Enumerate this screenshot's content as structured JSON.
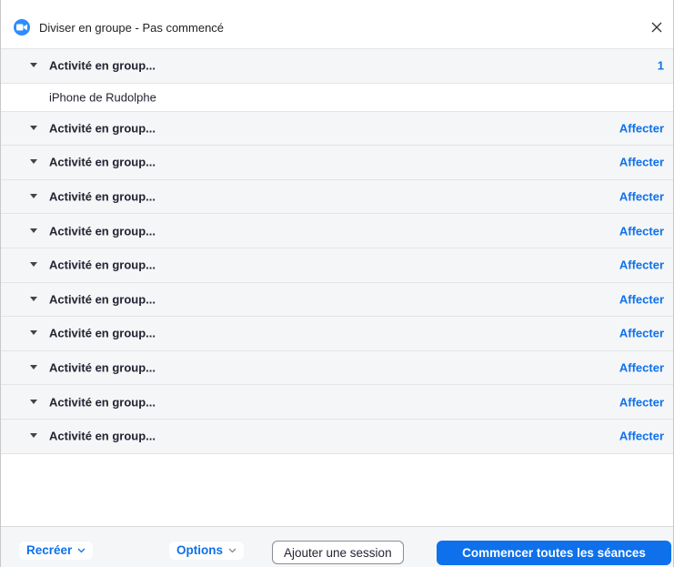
{
  "window": {
    "title": "Diviser en groupe - Pas commencé",
    "app_icon": "zoom-camera-icon",
    "close_icon": "close-icon"
  },
  "rooms": [
    {
      "name": "Activité en group...",
      "action": "1",
      "expanded": true,
      "members": [
        "iPhone de Rudolphe"
      ]
    },
    {
      "name": "Activité en group...",
      "action": "Affecter"
    },
    {
      "name": "Activité en group...",
      "action": "Affecter"
    },
    {
      "name": "Activité en group...",
      "action": "Affecter"
    },
    {
      "name": "Activité en group...",
      "action": "Affecter"
    },
    {
      "name": "Activité en group...",
      "action": "Affecter"
    },
    {
      "name": "Activité en group...",
      "action": "Affecter"
    },
    {
      "name": "Activité en group...",
      "action": "Affecter"
    },
    {
      "name": "Activité en group...",
      "action": "Affecter"
    },
    {
      "name": "Activité en group...",
      "action": "Affecter"
    },
    {
      "name": "Activité en group...",
      "action": "Affecter"
    }
  ],
  "footer": {
    "recreate_label": "Recréer",
    "options_label": "Options",
    "add_session_label": "Ajouter une session",
    "start_all_label": "Commencer toutes les séances"
  },
  "colors": {
    "accent": "#0e71eb",
    "row_bg": "#f5f6f7",
    "app_icon": "#2d8cff"
  }
}
